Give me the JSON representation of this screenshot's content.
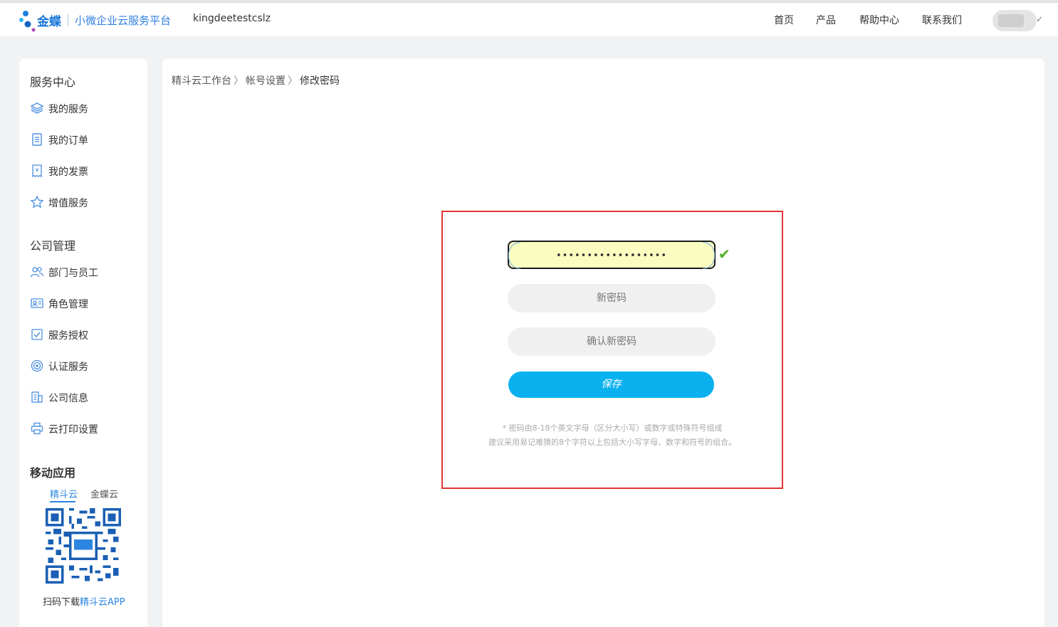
{
  "header": {
    "brand": "金蝶",
    "platform": "小微企业云服务平台",
    "account": "kingdeetestcslz",
    "nav": [
      "首页",
      "产品",
      "帮助中心",
      "联系我们"
    ],
    "avatar_check": "✓"
  },
  "sidebar": {
    "service_center": {
      "title": "服务中心",
      "items": [
        {
          "label": "我的服务",
          "icon": "layers-icon"
        },
        {
          "label": "我的订单",
          "icon": "document-icon"
        },
        {
          "label": "我的发票",
          "icon": "invoice-icon"
        },
        {
          "label": "增值服务",
          "icon": "star-icon"
        }
      ]
    },
    "company": {
      "title": "公司管理",
      "items": [
        {
          "label": "部门与员工",
          "icon": "users-icon"
        },
        {
          "label": "角色管理",
          "icon": "id-card-icon"
        },
        {
          "label": "服务授权",
          "icon": "checkbox-icon"
        },
        {
          "label": "认证服务",
          "icon": "target-icon"
        },
        {
          "label": "公司信息",
          "icon": "building-icon"
        },
        {
          "label": "云打印设置",
          "icon": "printer-icon"
        }
      ]
    },
    "mobile": {
      "title": "移动应用",
      "tabs": [
        "精斗云",
        "金蝶云"
      ],
      "active_tab": "精斗云",
      "caption_prefix": "扫码下载",
      "caption_highlight": "精斗云APP"
    }
  },
  "main": {
    "breadcrumb": [
      "精斗云工作台",
      "帐号设置",
      "修改密码"
    ],
    "breadcrumb_sep": "〉",
    "form": {
      "current_password_value": "••••••••••••••••••",
      "new_password_placeholder": "新密码",
      "confirm_password_placeholder": "确认新密码",
      "save_label": "保存",
      "hint_line1": "* 密码由8-18个英文字母（区分大小写）或数字或特殊符号组成",
      "hint_line2": "建议采用易记难猜的8个字符以上包括大小写字母、数字和符号的组合。"
    }
  },
  "colors": {
    "accent": "#2a86e0",
    "save_button": "#0bb1ef",
    "highlight_border": "#e03535",
    "check": "#4caf1f"
  }
}
